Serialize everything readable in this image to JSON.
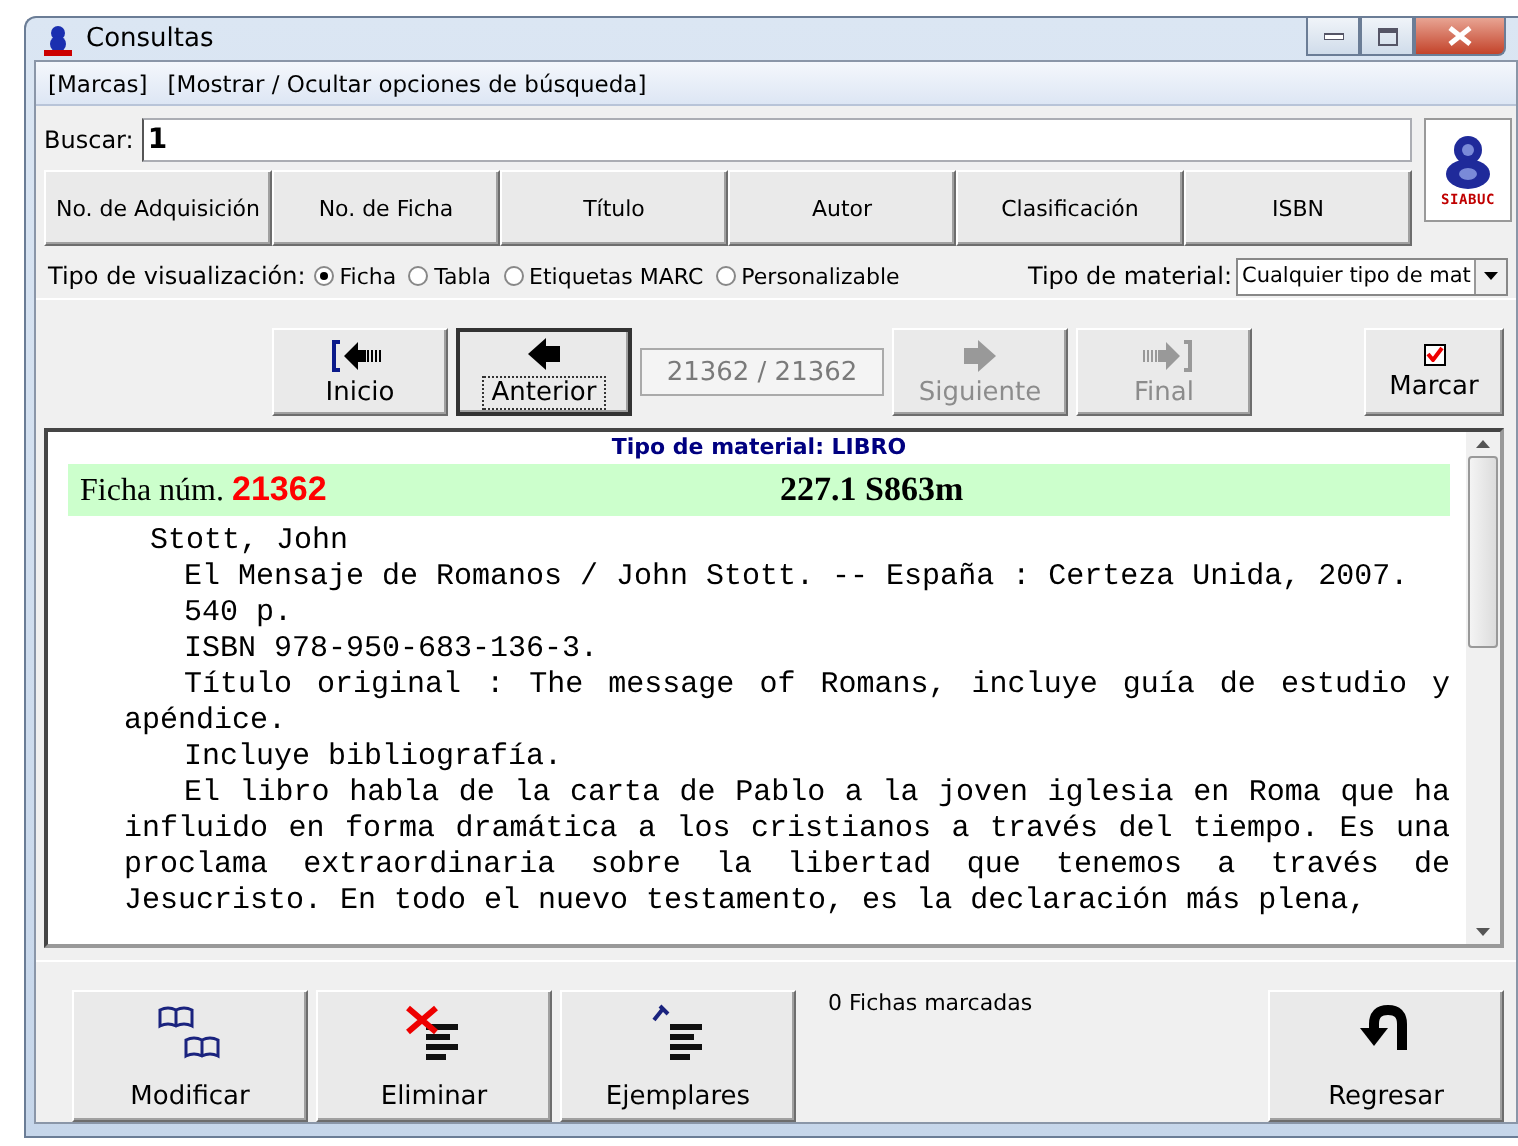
{
  "window": {
    "title": "Consultas"
  },
  "menu": [
    {
      "label": "[Marcas]"
    },
    {
      "label": "[Mostrar / Ocultar opciones de búsqueda]"
    }
  ],
  "search": {
    "label": "Buscar:",
    "value": "1"
  },
  "logo": {
    "text": "SIABUC"
  },
  "search_buttons": [
    "No. de Adquisición",
    "No. de Ficha",
    "Título",
    "Autor",
    "Clasificación",
    "ISBN"
  ],
  "view": {
    "label": "Tipo de visualización:",
    "options": [
      {
        "label": "Ficha",
        "selected": true
      },
      {
        "label": "Tabla",
        "selected": false
      },
      {
        "label": "Etiquetas MARC",
        "selected": false
      },
      {
        "label": "Personalizable",
        "selected": false
      }
    ]
  },
  "material": {
    "label": "Tipo de material:",
    "value": "Cualquier tipo de mat"
  },
  "nav": [
    {
      "kind": "first",
      "label": "Inicio",
      "disabled": false,
      "focused": false
    },
    {
      "kind": "prev",
      "label": "Anterior",
      "disabled": false,
      "focused": true
    },
    {
      "kind": "counter",
      "label": "21362 / 21362",
      "disabled": true,
      "focused": false
    },
    {
      "kind": "next",
      "label": "Siguiente",
      "disabled": true,
      "focused": false
    },
    {
      "kind": "last",
      "label": "Final",
      "disabled": true,
      "focused": false
    }
  ],
  "mark": {
    "label": "Marcar",
    "checked": true
  },
  "record": {
    "header": "Tipo de material: LIBRO",
    "number_label": "Ficha núm.",
    "number": "21362",
    "call_number": "227.1 S863m",
    "lines": [
      {
        "kind": "author",
        "text": "Stott, John"
      },
      {
        "kind": "para",
        "text": "El Mensaje de Romanos / John Stott. -- España : Certeza Unida, 2007."
      },
      {
        "kind": "para",
        "text": "540 p."
      },
      {
        "kind": "para",
        "text": "ISBN 978-950-683-136-3."
      },
      {
        "kind": "para",
        "text": "Título original : The message of Romans, incluye guía de estudio y apéndice."
      },
      {
        "kind": "para",
        "text": "Incluye bibliografía."
      },
      {
        "kind": "para",
        "text": "El libro habla de la carta de Pablo a la joven iglesia en Roma que ha influido en forma dramática a los cristianos a través del tiempo. Es una proclama extraordinaria sobre la libertad que tenemos a través de Jesucristo. En todo el nuevo testamento, es la declaración más plena,"
      }
    ]
  },
  "actions": [
    {
      "kind": "edit",
      "label": "Modificar"
    },
    {
      "kind": "delete",
      "label": "Eliminar"
    },
    {
      "kind": "copies",
      "label": "Ejemplares"
    }
  ],
  "marked_count": "0 Fichas marcadas",
  "back": {
    "label": "Regresar"
  }
}
